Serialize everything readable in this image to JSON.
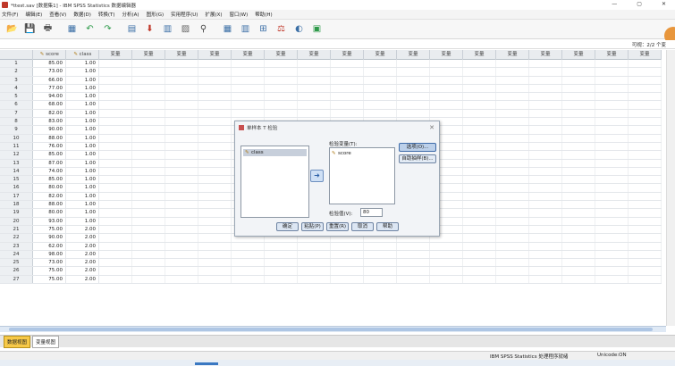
{
  "window": {
    "title": "*ttest.sav [数据集1] - IBM SPSS Statistics 数据编辑器",
    "controls": [
      "—",
      "▢",
      "✕"
    ]
  },
  "menu": [
    "文件(F)",
    "编辑(E)",
    "查看(V)",
    "数据(D)",
    "转换(T)",
    "分析(A)",
    "图形(G)",
    "实用程序(U)",
    "扩展(X)",
    "窗口(W)",
    "帮助(H)"
  ],
  "toolbar_icons": [
    "open-icon",
    "save-icon",
    "print-icon",
    "dialog-recall-icon",
    "undo-icon",
    "redo-icon",
    "goto-case-icon",
    "goto-variable-icon",
    "variables-icon",
    "run-descriptives-icon",
    "find-icon",
    "insert-cases-icon",
    "insert-variable-icon",
    "split-file-icon",
    "weight-cases-icon",
    "select-cases-icon",
    "value-labels-icon",
    "use-sets-icon"
  ],
  "filter_bar": {
    "visible_count": "可视：2/2 个变"
  },
  "grid": {
    "columns": [
      "score",
      "class",
      "变量",
      "变量",
      "变量",
      "变量",
      "变量",
      "变量",
      "变量",
      "变量",
      "变量",
      "变量",
      "变量",
      "变量",
      "变量",
      "变量",
      "变量",
      "变量",
      "变量"
    ],
    "rows": [
      {
        "n": "1",
        "score": "85.00",
        "class": "1.00"
      },
      {
        "n": "2",
        "score": "73.00",
        "class": "1.00"
      },
      {
        "n": "3",
        "score": "66.00",
        "class": "1.00"
      },
      {
        "n": "4",
        "score": "77.00",
        "class": "1.00"
      },
      {
        "n": "5",
        "score": "94.00",
        "class": "1.00"
      },
      {
        "n": "6",
        "score": "68.00",
        "class": "1.00"
      },
      {
        "n": "7",
        "score": "82.00",
        "class": "1.00"
      },
      {
        "n": "8",
        "score": "83.00",
        "class": "1.00"
      },
      {
        "n": "9",
        "score": "90.00",
        "class": "1.00"
      },
      {
        "n": "10",
        "score": "88.00",
        "class": "1.00"
      },
      {
        "n": "11",
        "score": "76.00",
        "class": "1.00"
      },
      {
        "n": "12",
        "score": "85.00",
        "class": "1.00"
      },
      {
        "n": "13",
        "score": "87.00",
        "class": "1.00"
      },
      {
        "n": "14",
        "score": "74.00",
        "class": "1.00"
      },
      {
        "n": "15",
        "score": "85.00",
        "class": "1.00"
      },
      {
        "n": "16",
        "score": "80.00",
        "class": "1.00"
      },
      {
        "n": "17",
        "score": "82.00",
        "class": "1.00"
      },
      {
        "n": "18",
        "score": "88.00",
        "class": "1.00"
      },
      {
        "n": "19",
        "score": "80.00",
        "class": "1.00"
      },
      {
        "n": "20",
        "score": "93.00",
        "class": "1.00"
      },
      {
        "n": "21",
        "score": "75.00",
        "class": "2.00"
      },
      {
        "n": "22",
        "score": "90.00",
        "class": "2.00"
      },
      {
        "n": "23",
        "score": "62.00",
        "class": "2.00"
      },
      {
        "n": "24",
        "score": "98.00",
        "class": "2.00"
      },
      {
        "n": "25",
        "score": "73.00",
        "class": "2.00"
      },
      {
        "n": "26",
        "score": "75.00",
        "class": "2.00"
      },
      {
        "n": "27",
        "score": "75.00",
        "class": "2.00"
      }
    ]
  },
  "tabs": [
    "数据视图",
    "变量视图"
  ],
  "status": {
    "processor": "IBM SPSS Statistics 处理程序就绪",
    "encoding": "Unicode:ON"
  },
  "dialog": {
    "title": "单样本 T 检验",
    "source_vars": [
      "class"
    ],
    "test_vars_label": "检验变量(T):",
    "test_vars": [
      "score"
    ],
    "test_value_label": "检验值(V):",
    "test_value": "80",
    "side_buttons": [
      "选项(O)...",
      "自助抽样(B)..."
    ],
    "buttons": [
      "确定",
      "粘贴(P)",
      "重置(R)",
      "取消",
      "帮助"
    ]
  }
}
